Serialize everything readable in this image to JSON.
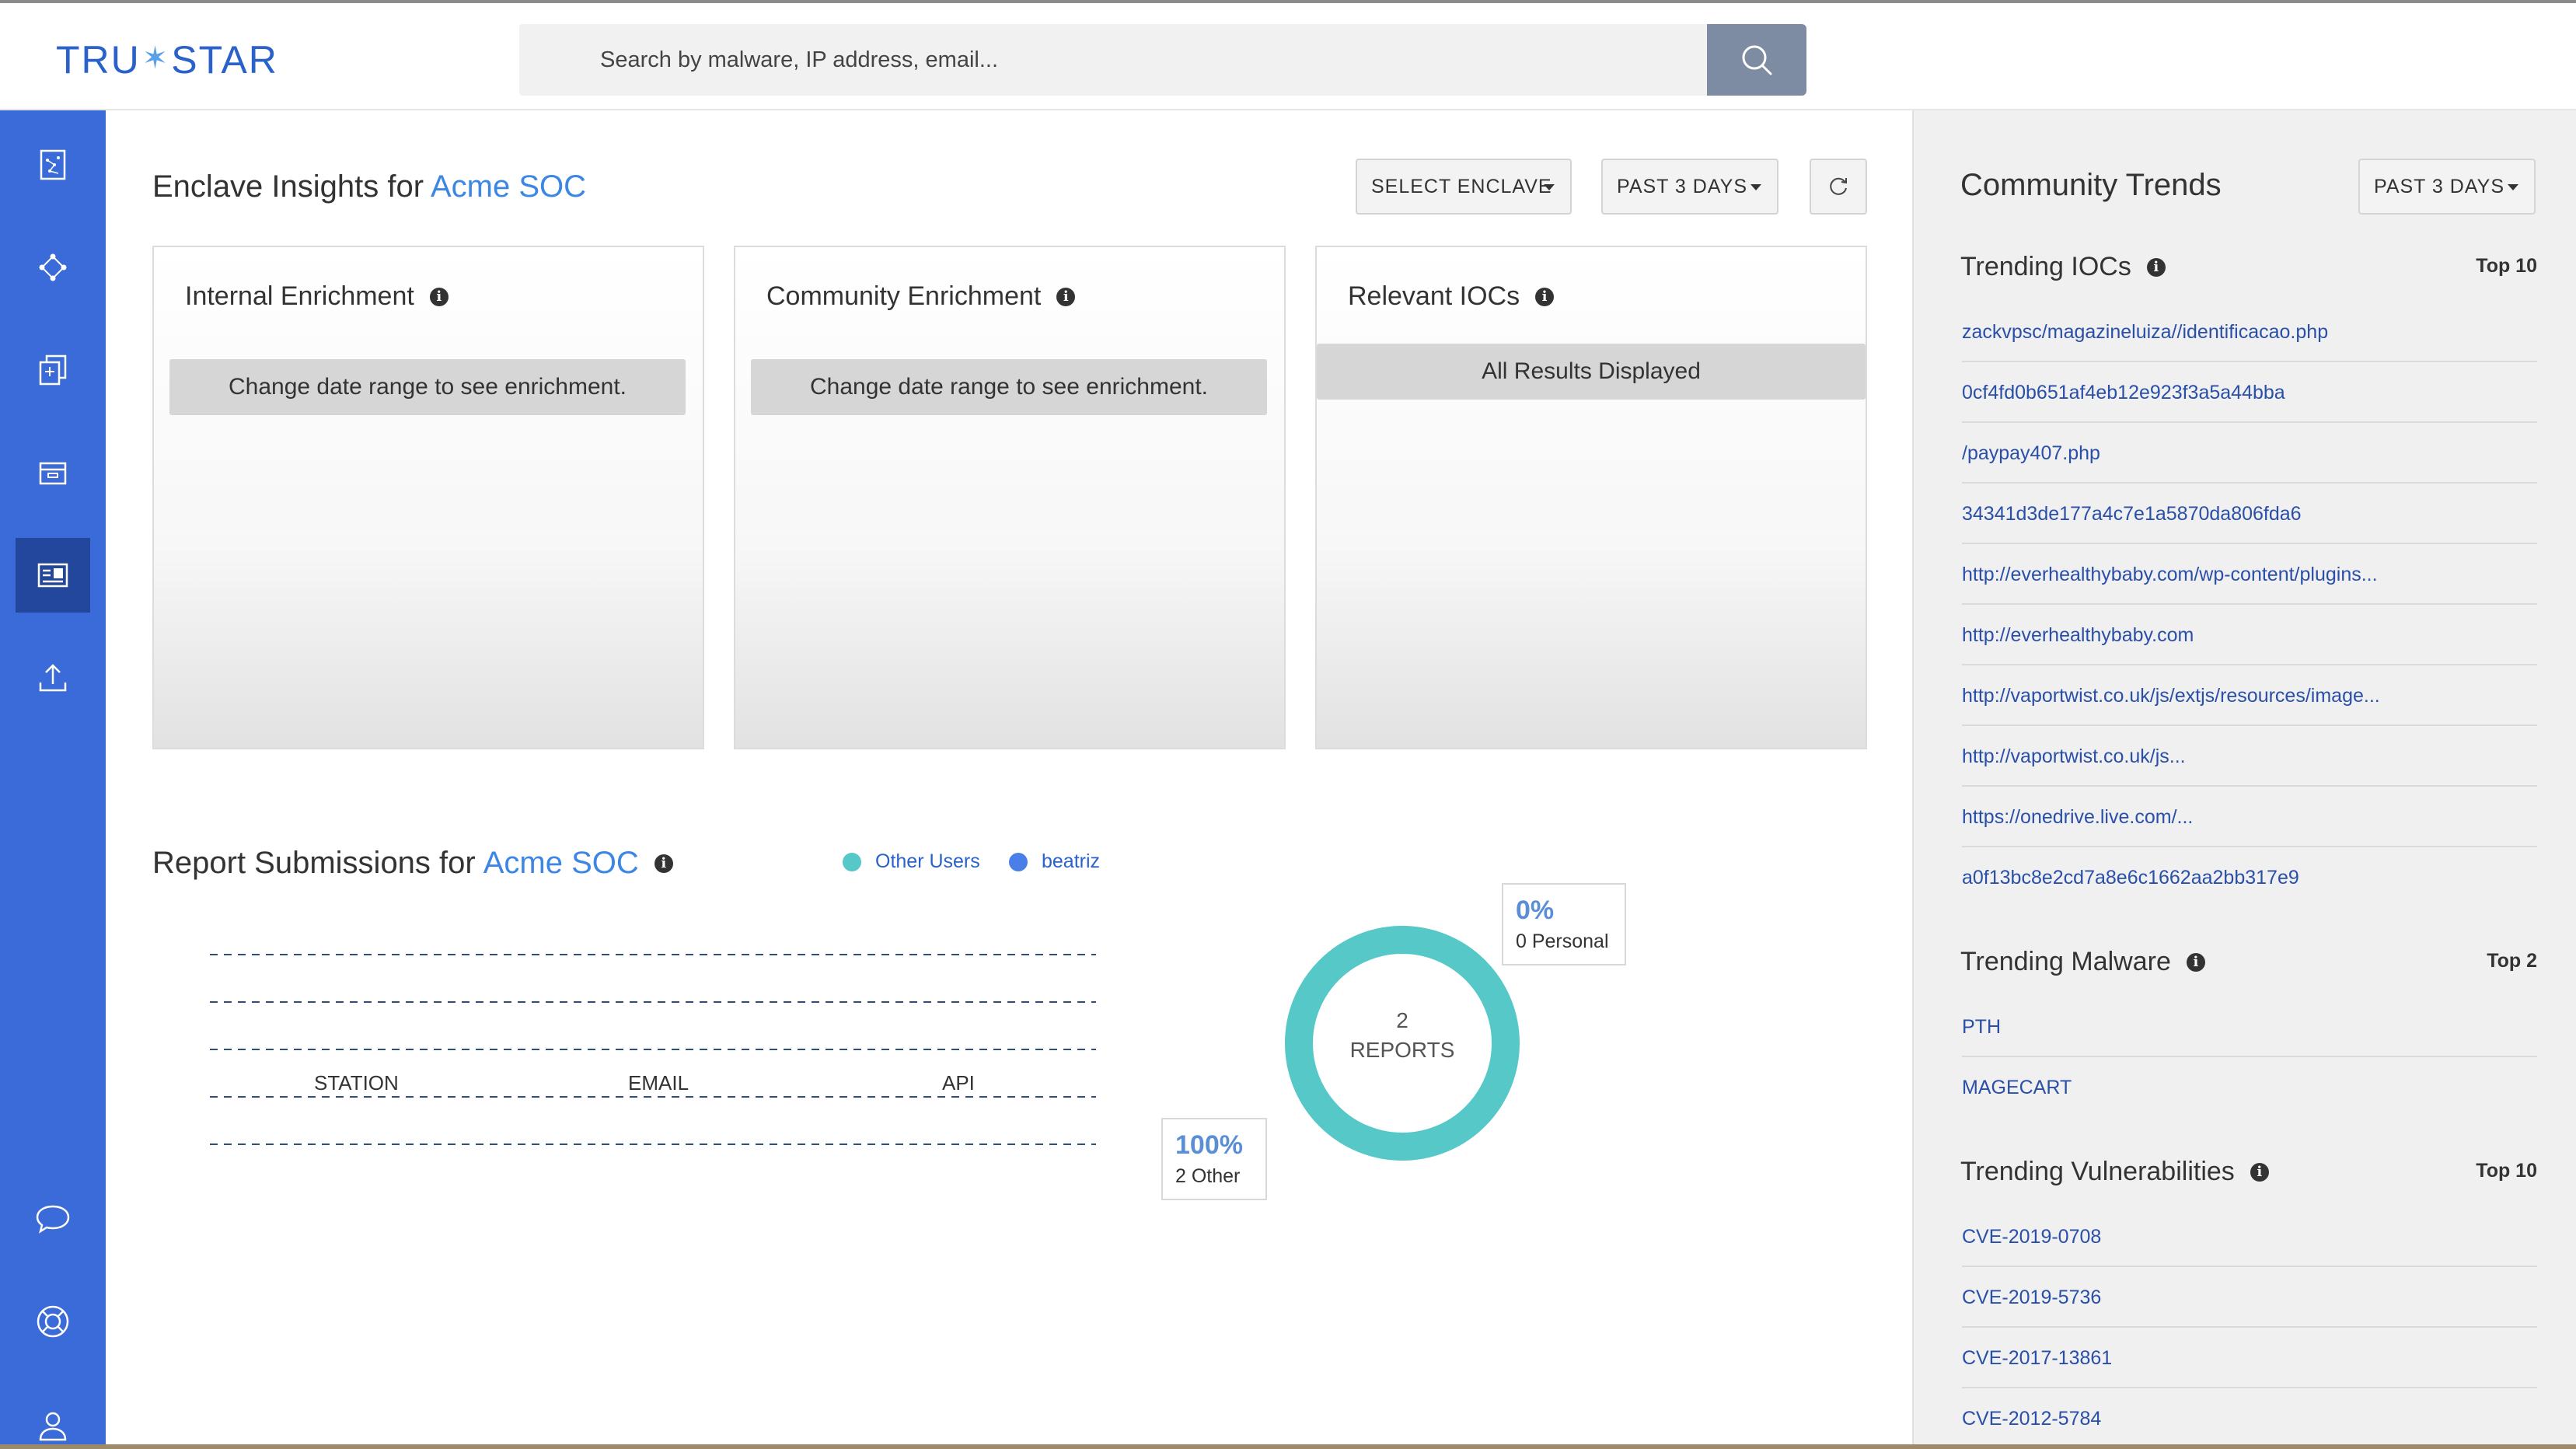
{
  "app": {
    "logo": "TRU*STAR",
    "search_placeholder": "Search by malware, IP address, email..."
  },
  "sidebar": {
    "items": [
      {
        "name": "reports",
        "icon": "document-chart-icon"
      },
      {
        "name": "graph",
        "icon": "network-icon"
      },
      {
        "name": "copy",
        "icon": "copy-document-icon"
      },
      {
        "name": "inbox",
        "icon": "inbox-icon"
      },
      {
        "name": "dashboard",
        "icon": "dashboard-card-icon",
        "active": true
      },
      {
        "name": "upload",
        "icon": "upload-icon"
      },
      {
        "name": "chat",
        "icon": "chat-bubble-icon"
      },
      {
        "name": "help",
        "icon": "lifebuoy-icon"
      },
      {
        "name": "profile",
        "icon": "user-icon"
      }
    ]
  },
  "enclave_insights": {
    "title_prefix": "Enclave Insights for ",
    "enclave_name": "Acme SOC",
    "select_enclave": "SELECT ENCLAVE",
    "date_range": "PAST 3 DAYS",
    "cards": [
      {
        "title": "Internal Enrichment",
        "message": "Change date range to see enrichment."
      },
      {
        "title": "Community Enrichment",
        "message": "Change date range to see enrichment."
      },
      {
        "title": "Relevant IOCs",
        "message": "All Results Displayed"
      }
    ]
  },
  "report_submissions": {
    "title_prefix": "Report Submissions for ",
    "enclave_name": "Acme SOC",
    "legend": [
      {
        "label": "Other Users",
        "color": "#57c8c8"
      },
      {
        "label": "beatriz",
        "color": "#4a7fe8"
      }
    ],
    "bar_labels": [
      "STATION",
      "EMAIL",
      "API"
    ],
    "donut": {
      "count": "2",
      "count_label": "REPORTS",
      "personal_pct": "0%",
      "personal_label": "0 Personal",
      "other_pct": "100%",
      "other_label": "2 Other"
    }
  },
  "chart_data": {
    "type": "pie",
    "categories": [
      "Other",
      "Personal"
    ],
    "values": [
      2,
      0
    ],
    "title": ""
  },
  "community_trends": {
    "title": "Community Trends",
    "date_range": "PAST 3 DAYS",
    "trending_iocs": {
      "title": "Trending IOCs",
      "top": "Top 10",
      "items": [
        "zackvpsc/magazineluiza//identificacao.php",
        "0cf4fd0b651af4eb12e923f3a5a44bba",
        "/paypay407.php",
        "34341d3de177a4c7e1a5870da806fda6",
        "http://everhealthybaby.com/wp-content/plugins...",
        "http://everhealthybaby.com",
        "http://vaportwist.co.uk/js/extjs/resources/image...",
        "http://vaportwist.co.uk/js...",
        "https://onedrive.live.com/...",
        "a0f13bc8e2cd7a8e6c1662aa2bb317e9"
      ]
    },
    "trending_malware": {
      "title": "Trending Malware",
      "top": "Top 2",
      "items": [
        "PTH",
        "MAGECART"
      ]
    },
    "trending_vulnerabilities": {
      "title": "Trending Vulnerabilities",
      "top": "Top 10",
      "items": [
        "CVE-2019-0708",
        "CVE-2019-5736",
        "CVE-2017-13861",
        "CVE-2012-5784"
      ]
    }
  }
}
